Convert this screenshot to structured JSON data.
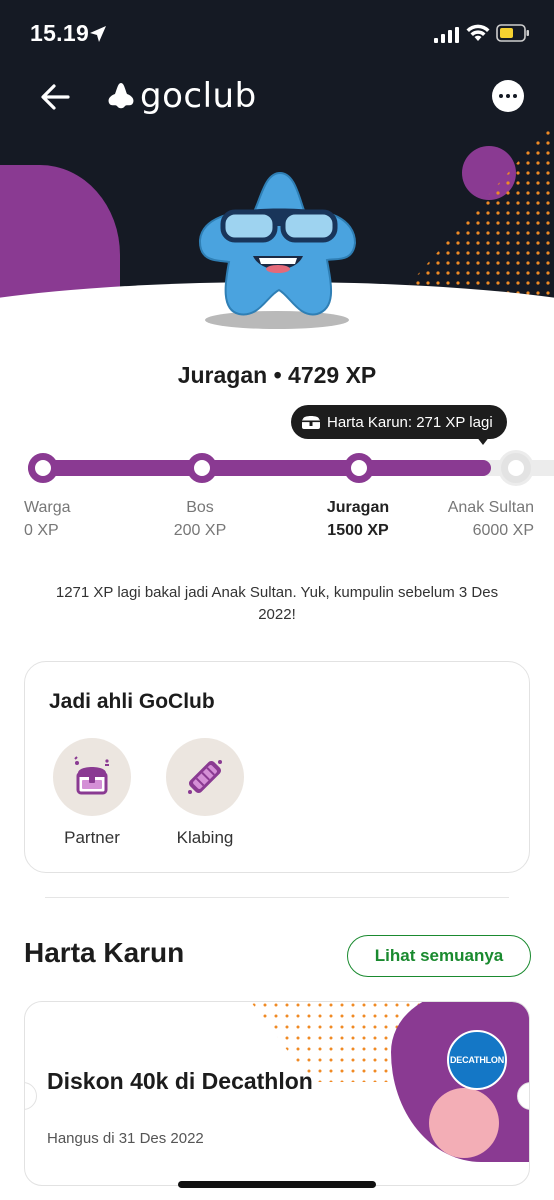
{
  "status_bar": {
    "time": "15.19"
  },
  "header": {
    "logo_text": "goclub"
  },
  "level": {
    "title": "Juragan • 4729 XP"
  },
  "progress": {
    "tooltip": "Harta Karun: 271 XP lagi",
    "fill_fraction": 0.88,
    "tiers": [
      {
        "name": "Warga",
        "xp": "0 XP",
        "current": false
      },
      {
        "name": "Bos",
        "xp": "200 XP",
        "current": false
      },
      {
        "name": "Juragan",
        "xp": "1500 XP",
        "current": true
      },
      {
        "name": "Anak Sultan",
        "xp": "6000 XP",
        "current": false
      }
    ]
  },
  "note": "1271 XP lagi bakal jadi Anak Sultan. Yuk, kumpulin sebelum 3 Des 2022!",
  "membership_card": {
    "title": "Jadi ahli GoClub",
    "features": [
      {
        "label": "Partner",
        "icon": "treasure-chest-icon"
      },
      {
        "label": "Klabing",
        "icon": "ticket-roll-icon"
      }
    ]
  },
  "treasure_section": {
    "title": "Harta Karun",
    "see_all": "Lihat semuanya",
    "voucher": {
      "title": "Diskon 40k di Decathlon",
      "expiry": "Hangus di 31 Des 2022",
      "brand": "DECATHLON"
    }
  },
  "colors": {
    "brand_purple": "#8a3a92",
    "accent_green": "#1a8a2f",
    "header_dark": "#151a24"
  }
}
